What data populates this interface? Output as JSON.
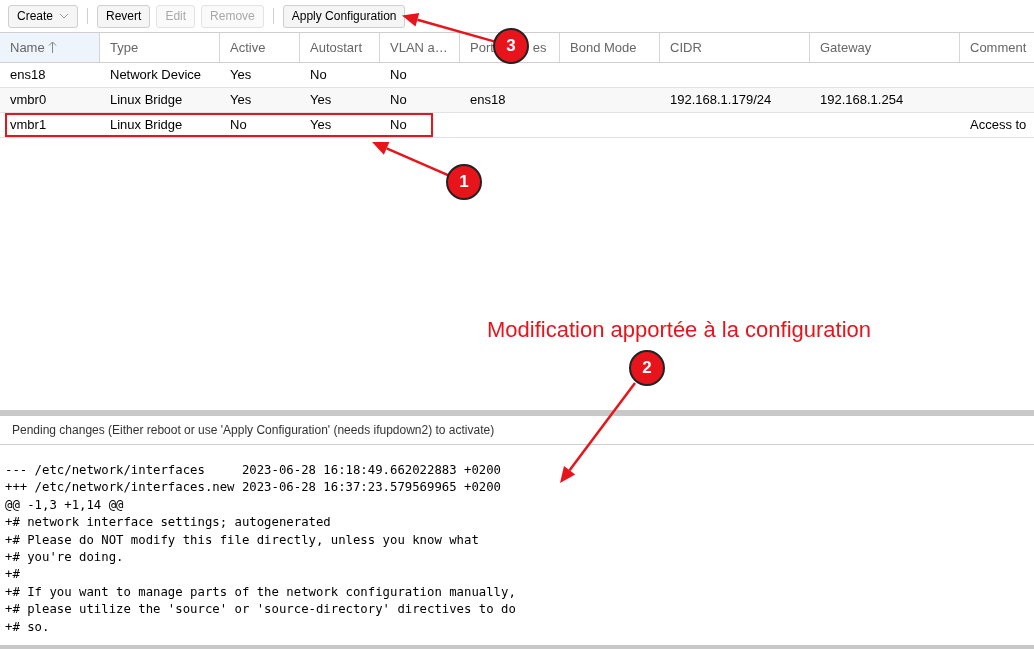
{
  "toolbar": [
    {
      "label": "Create",
      "dropdown": true,
      "disabled": false
    },
    {
      "label": "Revert",
      "dropdown": false,
      "disabled": false
    },
    {
      "label": "Edit",
      "dropdown": false,
      "disabled": true
    },
    {
      "label": "Remove",
      "dropdown": false,
      "disabled": true
    },
    {
      "label": "Apply Configuration",
      "dropdown": false,
      "disabled": false
    }
  ],
  "table": {
    "columns": [
      {
        "label": "Name",
        "sorted": true
      },
      {
        "label": "Type",
        "sorted": false
      },
      {
        "label": "Active",
        "sorted": false
      },
      {
        "label": "Autostart",
        "sorted": false
      },
      {
        "label": "VLAN a…",
        "sorted": false
      },
      {
        "label": "Port",
        "label_end": "es",
        "sorted": false
      },
      {
        "label": "Bond Mode",
        "sorted": false
      },
      {
        "label": "CIDR",
        "sorted": false
      },
      {
        "label": "Gateway",
        "sorted": false
      },
      {
        "label": "Comment",
        "sorted": false
      }
    ],
    "rows": [
      {
        "cells": [
          "ens18",
          "Network Device",
          "Yes",
          "No",
          "No",
          "",
          "",
          "",
          "",
          ""
        ],
        "highlighted": false
      },
      {
        "cells": [
          "vmbr0",
          "Linux Bridge",
          "Yes",
          "Yes",
          "No",
          "ens18",
          "",
          "192.168.1.179/24",
          "192.168.1.254",
          ""
        ],
        "highlighted": false
      },
      {
        "cells": [
          "vmbr1",
          "Linux Bridge",
          "No",
          "Yes",
          "No",
          "",
          "",
          "",
          "",
          "Access to"
        ],
        "highlighted": true
      }
    ]
  },
  "pending": {
    "title": "Pending changes (Either reboot or use 'Apply Configuration' (needs ifupdown2) to activate)",
    "lines": [
      "--- /etc/network/interfaces     2023-06-28 16:18:49.662022883 +0200",
      "+++ /etc/network/interfaces.new 2023-06-28 16:37:23.579569965 +0200",
      "@@ -1,3 +1,14 @@",
      "+# network interface settings; autogenerated",
      "+# Please do NOT modify this file directly, unless you know what",
      "+# you're doing.",
      "+#",
      "+# If you want to manage parts of the network configuration manually,",
      "+# please utilize the 'source' or 'source-directory' directives to do",
      "+# so."
    ]
  },
  "annotations": {
    "caption": "Modification apportée à la configuration",
    "badges": [
      "1",
      "2",
      "3"
    ]
  }
}
